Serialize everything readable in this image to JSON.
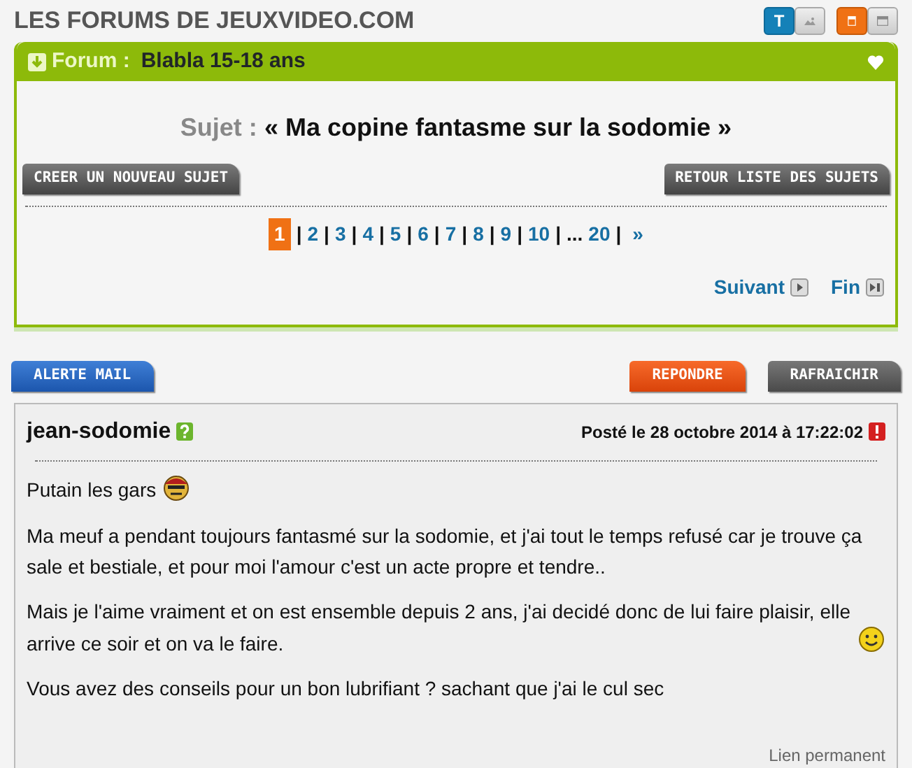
{
  "header": {
    "title": "LES FORUMS DE JEUXVIDEO.COM",
    "view_toggles": [
      {
        "kind": "text",
        "label": "T",
        "selected": true
      },
      {
        "kind": "image",
        "selected": false
      }
    ],
    "layout_toggles": [
      {
        "kind": "narrow",
        "selected": true
      },
      {
        "kind": "wide",
        "selected": false
      }
    ]
  },
  "forum": {
    "label": "Forum :",
    "name": "Blabla 15-18 ans",
    "subject_label": "Sujet :",
    "subject": "« Ma copine fantasme sur la sodomie »",
    "buttons": [
      "CREER UN NOUVEAU SUJET",
      "RETOUR LISTE DES SUJETS"
    ],
    "pages": [
      {
        "label": "1",
        "kind": "page",
        "selected": true
      },
      {
        "label": "|",
        "kind": "separator"
      },
      {
        "label": "2",
        "kind": "page",
        "selected": false
      },
      {
        "label": "|",
        "kind": "separator"
      },
      {
        "label": "3",
        "kind": "page",
        "selected": false
      },
      {
        "label": "|",
        "kind": "separator"
      },
      {
        "label": "4",
        "kind": "page",
        "selected": false
      },
      {
        "label": "|",
        "kind": "separator"
      },
      {
        "label": "5",
        "kind": "page",
        "selected": false
      },
      {
        "label": "|",
        "kind": "separator"
      },
      {
        "label": "6",
        "kind": "page",
        "selected": false
      },
      {
        "label": "|",
        "kind": "separator"
      },
      {
        "label": "7",
        "kind": "page",
        "selected": false
      },
      {
        "label": "|",
        "kind": "separator"
      },
      {
        "label": "8",
        "kind": "page",
        "selected": false
      },
      {
        "label": "|",
        "kind": "separator"
      },
      {
        "label": "9",
        "kind": "page",
        "selected": false
      },
      {
        "label": "|",
        "kind": "separator"
      },
      {
        "label": "10",
        "kind": "page",
        "selected": false
      },
      {
        "label": "|",
        "kind": "separator"
      },
      {
        "label": "...",
        "kind": "gap"
      },
      {
        "label": "20",
        "kind": "page",
        "selected": false
      },
      {
        "label": "|",
        "kind": "separator"
      },
      {
        "label": "»",
        "kind": "next"
      }
    ],
    "nav": [
      {
        "label": "Suivant",
        "kind": "next"
      },
      {
        "label": "Fin",
        "kind": "last"
      }
    ]
  },
  "actions": [
    {
      "label": "ALERTE MAIL",
      "kind": "blue"
    },
    {
      "label": "REPONDRE",
      "kind": "orange"
    },
    {
      "label": "RAFRAICHIR",
      "kind": "grey"
    }
  ],
  "post": {
    "author": "jean-sodomie",
    "date": "Posté le 28 octobre 2014 à 17:22:02",
    "paragraphs": [
      {
        "text": "Putain les gars",
        "kind": "pirate_smiley"
      },
      {
        "text": "Ma meuf a pendant toujours fantasmé sur la sodomie, et j'ai tout le temps refusé car je trouve ça sale et bestiale, et pour moi l'amour c'est un acte propre et tendre..",
        "kind": "plain"
      },
      {
        "text": "Mais je l'aime vraiment et on est ensemble depuis 2 ans, j'ai decidé donc de lui faire plaisir, elle arrive ce soir et on va le faire.",
        "kind": "smiley"
      },
      {
        "text": "Vous avez des conseils pour un bon lubrifiant ? sachant que j'ai le cul sec",
        "kind": "plain"
      }
    ],
    "permalink": "Lien permanent"
  }
}
